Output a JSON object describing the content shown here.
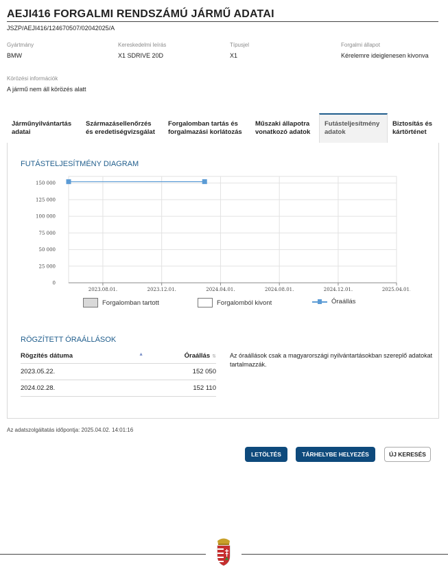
{
  "page": {
    "title": "AEJI416 FORGALMI RENDSZÁMÚ JÁRMŰ ADATAI",
    "reference": "JSZP/AEJI416/124670507/02042025/A"
  },
  "fields": {
    "manufacturer": {
      "label": "Gyártmány",
      "value": "BMW"
    },
    "commercial": {
      "label": "Kereskedelmi leírás",
      "value": "X1 SDRIVE 20D"
    },
    "type": {
      "label": "Típusjel",
      "value": "X1"
    },
    "status": {
      "label": "Forgalmi állapot",
      "value": "Kérelemre ideiglenesen kivonva"
    },
    "wanted": {
      "label": "Körözési információk",
      "value": "A jármű nem áll körözés alatt"
    }
  },
  "tabs": [
    {
      "line1": "Járműnyilvántartás",
      "line2": "adatai"
    },
    {
      "line1": "Származásellenőrzés",
      "line2": "és eredetiségvizsgálat"
    },
    {
      "line1": "Forgalomban tartás és",
      "line2": "forgalmazási korlátozás"
    },
    {
      "line1": "Műszaki állapotra",
      "line2": "vonatkozó adatok"
    },
    {
      "line1": "Futásteljesítmény",
      "line2": "adatok"
    },
    {
      "line1": "Biztosítás és",
      "line2": "kártörténet"
    }
  ],
  "diagram": {
    "title": "FUTÁSTELJESÍTMÉNY DIAGRAM",
    "legend": {
      "in_traffic": "Forgalomban tartott",
      "withdrawn": "Forgalomból kivont",
      "odometer": "Óraállás"
    }
  },
  "chart_data": {
    "type": "line",
    "x_ticks": [
      "2023.08.01.",
      "2023.12.01.",
      "2024.04.01.",
      "2024.08.01.",
      "2024.12.01.",
      "2025.04.01."
    ],
    "y_ticks": [
      "0",
      "25 000",
      "50 000",
      "75 000",
      "100 000",
      "125 000",
      "150 000"
    ],
    "ylim": [
      0,
      160000
    ],
    "xlim": [
      "2023-05-22",
      "2025-04-01"
    ],
    "grid": true,
    "legend_position": "bottom",
    "series": [
      {
        "name": "Óraállás",
        "color": "#5b9bd5",
        "x": [
          "2023-05-22",
          "2024-02-28"
        ],
        "values": [
          152050,
          152110
        ]
      }
    ]
  },
  "readings": {
    "title": "RÖGZÍTETT ÓRAÁLLÁSOK",
    "col_date": "Rögzítés dátuma",
    "col_odo": "Óraállás",
    "rows": [
      {
        "date": "2023.05.22.",
        "odo": "152 050"
      },
      {
        "date": "2024.02.28.",
        "odo": "152 110"
      }
    ],
    "note": "Az óraállások csak a magyarországi nyilvántartásokban szereplő adatokat tartalmazzák."
  },
  "timestamp": "Az adatszolgáltatás időpontja: 2025.04.02. 14:01:16",
  "buttons": {
    "download": "LETÖLTÉS",
    "store": "TÁRHELYBE HELYEZÉS",
    "new_search": "ÚJ KERESÉS"
  },
  "colors": {
    "accent": "#1f5d8c",
    "button": "#0e4a7c",
    "series": "#5b9bd5"
  }
}
